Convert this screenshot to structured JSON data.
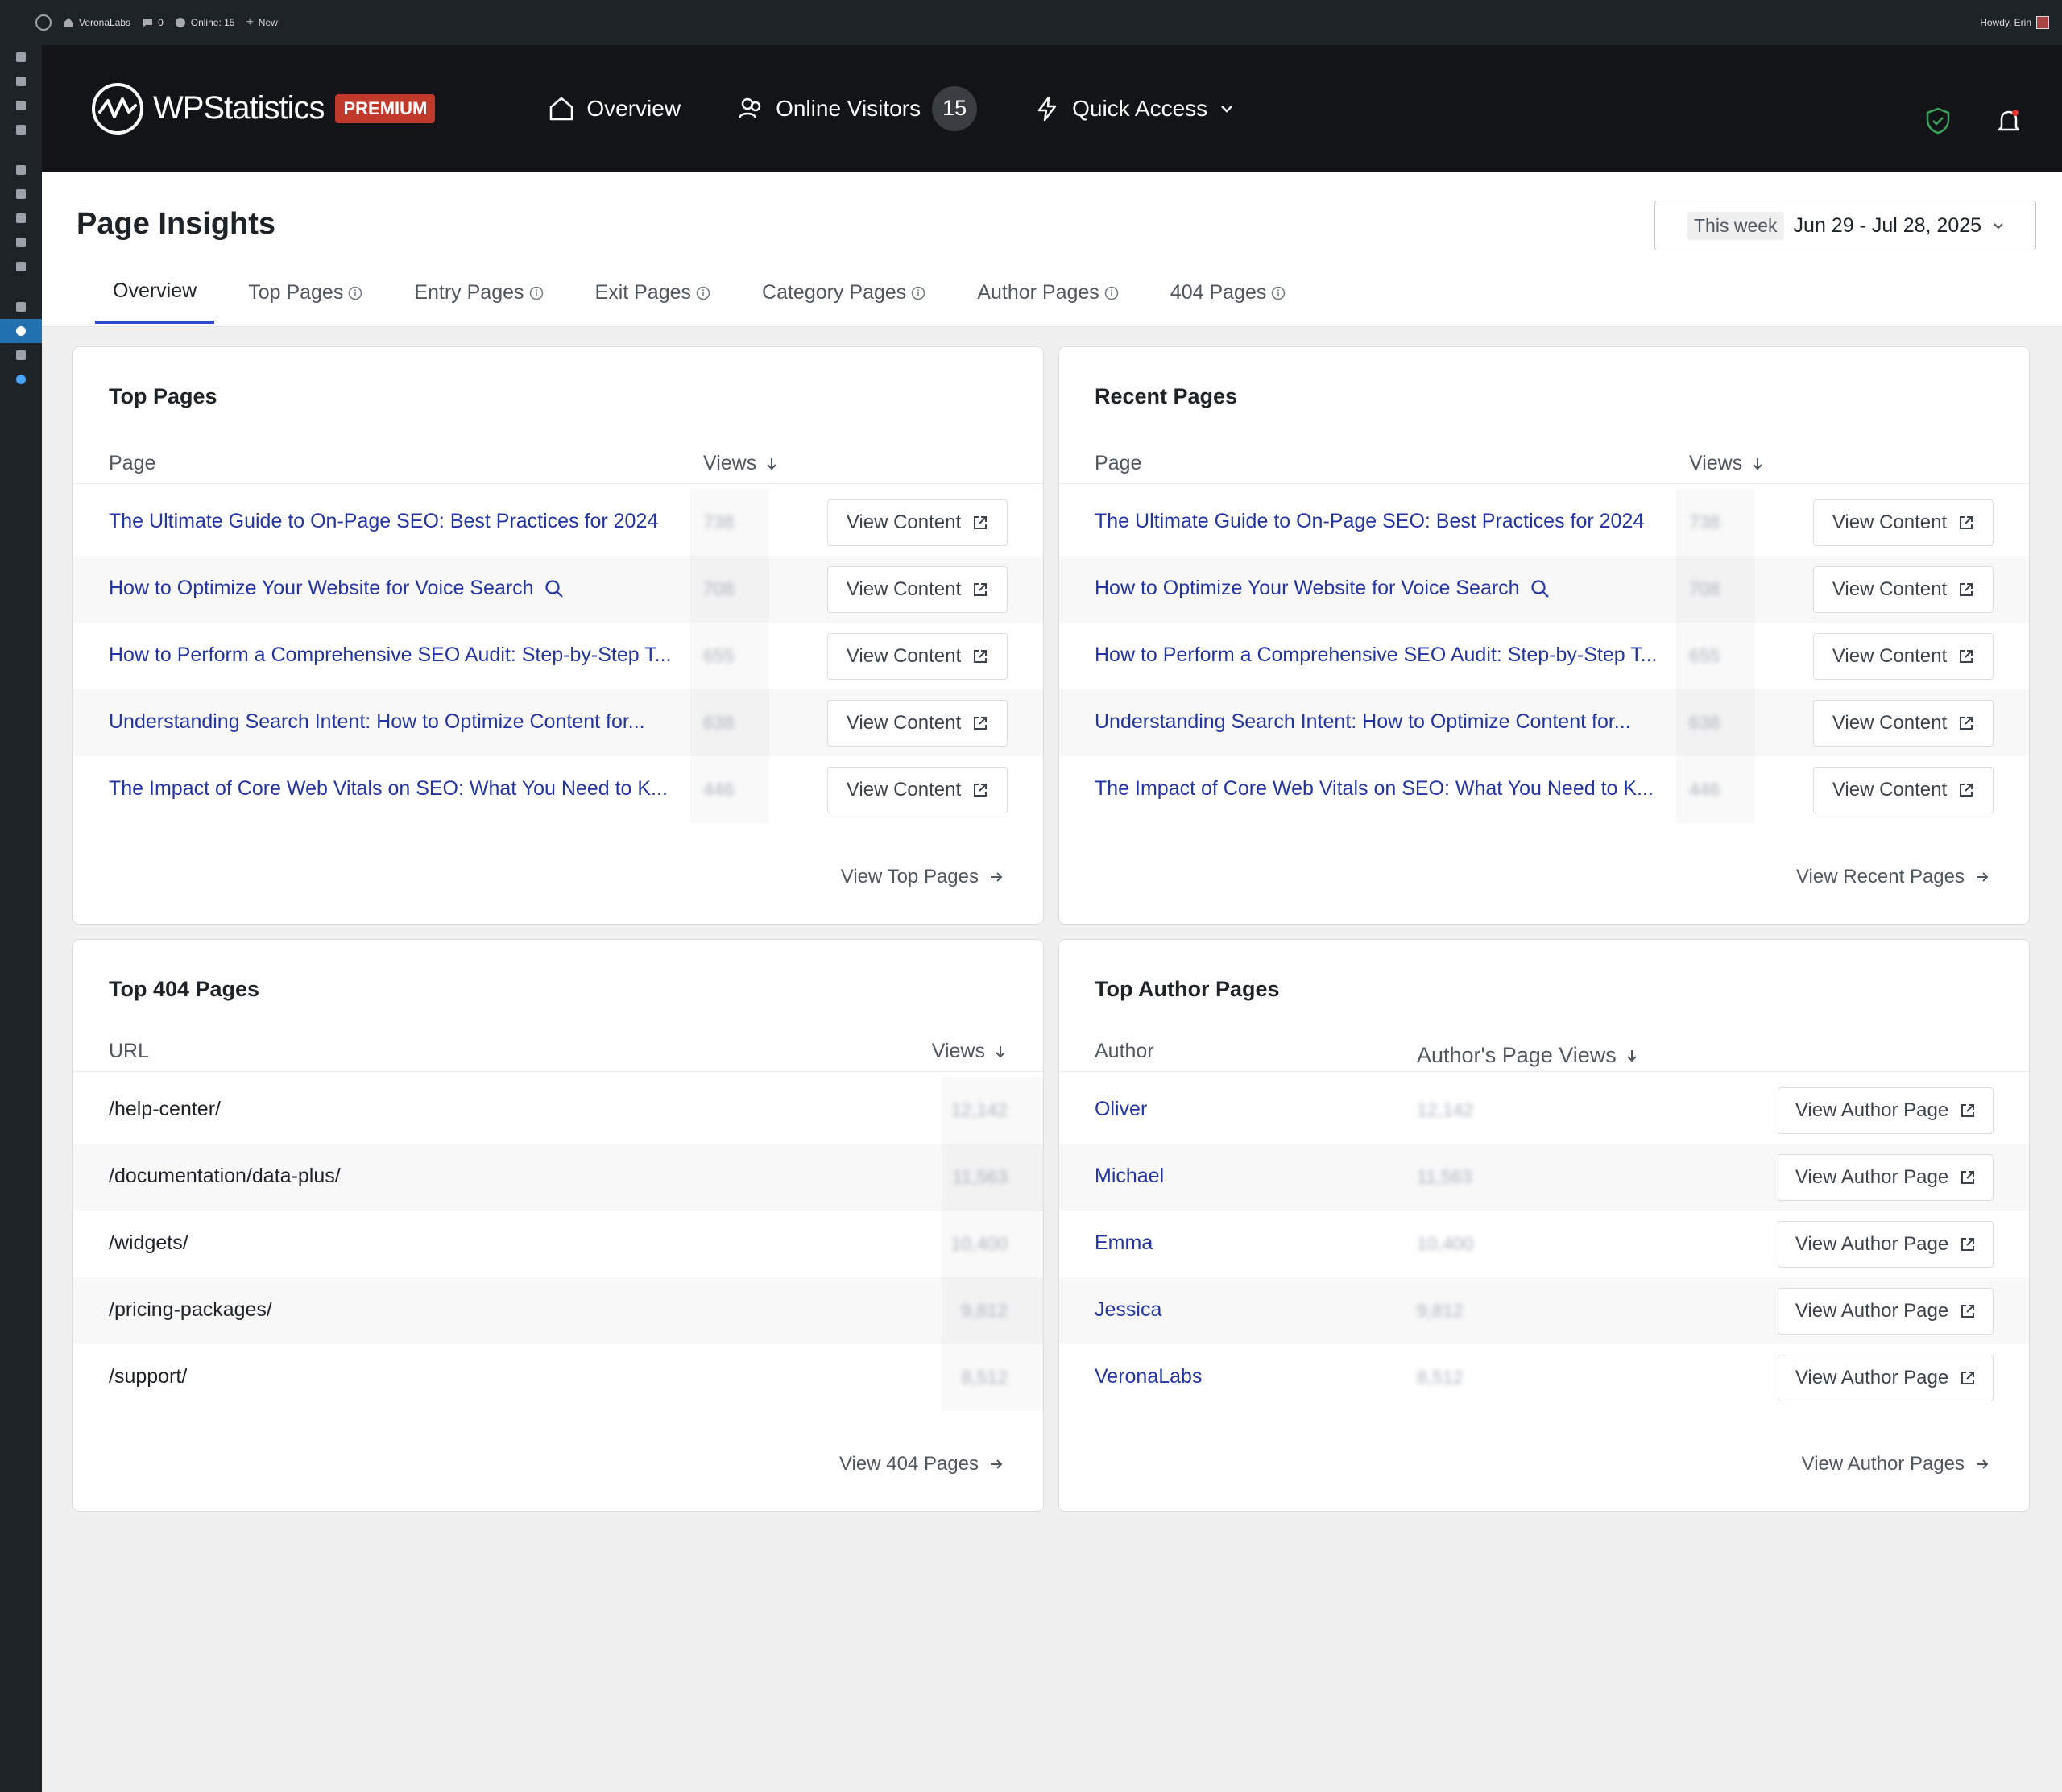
{
  "admin_bar": {
    "site_name": "VeronaLabs",
    "comments_count": "0",
    "online": "Online: 15",
    "new_label": "New",
    "howdy": "Howdy, Erin"
  },
  "header": {
    "brand": "WPStatistics",
    "badge": "PREMIUM",
    "nav": {
      "overview": "Overview",
      "online_visitors": "Online Visitors",
      "online_count": "15",
      "quick_access": "Quick Access"
    }
  },
  "page": {
    "title": "Page Insights",
    "date_chip": "This week",
    "date_range": "Jun 29 - Jul 28, 2025",
    "tabs": [
      "Overview",
      "Top Pages",
      "Entry Pages",
      "Exit Pages",
      "Category Pages",
      "Author Pages",
      "404 Pages"
    ]
  },
  "top_pages": {
    "title": "Top Pages",
    "col_page": "Page",
    "col_views": "Views",
    "button_label": "View Content",
    "footer_link": "View Top Pages",
    "rows": [
      {
        "title": "The Ultimate Guide to On-Page SEO: Best Practices for 2024",
        "views": "738"
      },
      {
        "title": "How to Optimize Your Website for Voice Search",
        "views": "708"
      },
      {
        "title": "How to Perform a Comprehensive SEO Audit: Step-by-Step T...",
        "views": "655"
      },
      {
        "title": "Understanding Search Intent: How to Optimize Content for...",
        "views": "638"
      },
      {
        "title": "The Impact of Core Web Vitals on SEO: What You Need to K...",
        "views": "446"
      }
    ]
  },
  "recent_pages": {
    "title": "Recent Pages",
    "col_page": "Page",
    "col_views": "Views",
    "button_label": "View Content",
    "footer_link": "View Recent Pages",
    "rows": [
      {
        "title": "The Ultimate Guide to On-Page SEO: Best Practices for 2024",
        "views": "738"
      },
      {
        "title": "How to Optimize Your Website for Voice Search",
        "views": "708"
      },
      {
        "title": "How to Perform a Comprehensive SEO Audit: Step-by-Step T...",
        "views": "655"
      },
      {
        "title": "Understanding Search Intent: How to Optimize Content for...",
        "views": "638"
      },
      {
        "title": "The Impact of Core Web Vitals on SEO: What You Need to K...",
        "views": "446"
      }
    ]
  },
  "top_404": {
    "title": "Top 404 Pages",
    "col_url": "URL",
    "col_views": "Views",
    "footer_link": "View 404 Pages",
    "rows": [
      {
        "url": "/help-center/",
        "views": "12,142"
      },
      {
        "url": "/documentation/data-plus/",
        "views": "11,563"
      },
      {
        "url": "/widgets/",
        "views": "10,400"
      },
      {
        "url": "/pricing-packages/",
        "views": "9,812"
      },
      {
        "url": "/support/",
        "views": "8,512"
      }
    ]
  },
  "top_authors": {
    "title": "Top Author Pages",
    "col_author": "Author",
    "col_views": "Author's Page Views",
    "button_label": "View Author Page",
    "footer_link": "View Author Pages",
    "rows": [
      {
        "author": "Oliver",
        "views": "12,142"
      },
      {
        "author": "Michael",
        "views": "11,563"
      },
      {
        "author": "Emma",
        "views": "10,400"
      },
      {
        "author": "Jessica",
        "views": "9,812"
      },
      {
        "author": "VeronaLabs",
        "views": "8,512"
      }
    ]
  },
  "icons": {
    "home": "home-icon",
    "visitors": "users-icon",
    "quick": "bolt-icon",
    "shield": "shield-check-icon",
    "bell": "bell-icon",
    "external": "external-link-icon",
    "arrow_down": "arrow-down-icon",
    "arrow_right": "arrow-right-icon",
    "search": "search-icon",
    "info": "info-icon"
  },
  "colors": {
    "header_bg": "#121417",
    "accent": "#3049d0",
    "link": "#2335a0",
    "premium": "#c0392b",
    "shield": "#3aa35c",
    "bell_dot": "#e53935"
  }
}
